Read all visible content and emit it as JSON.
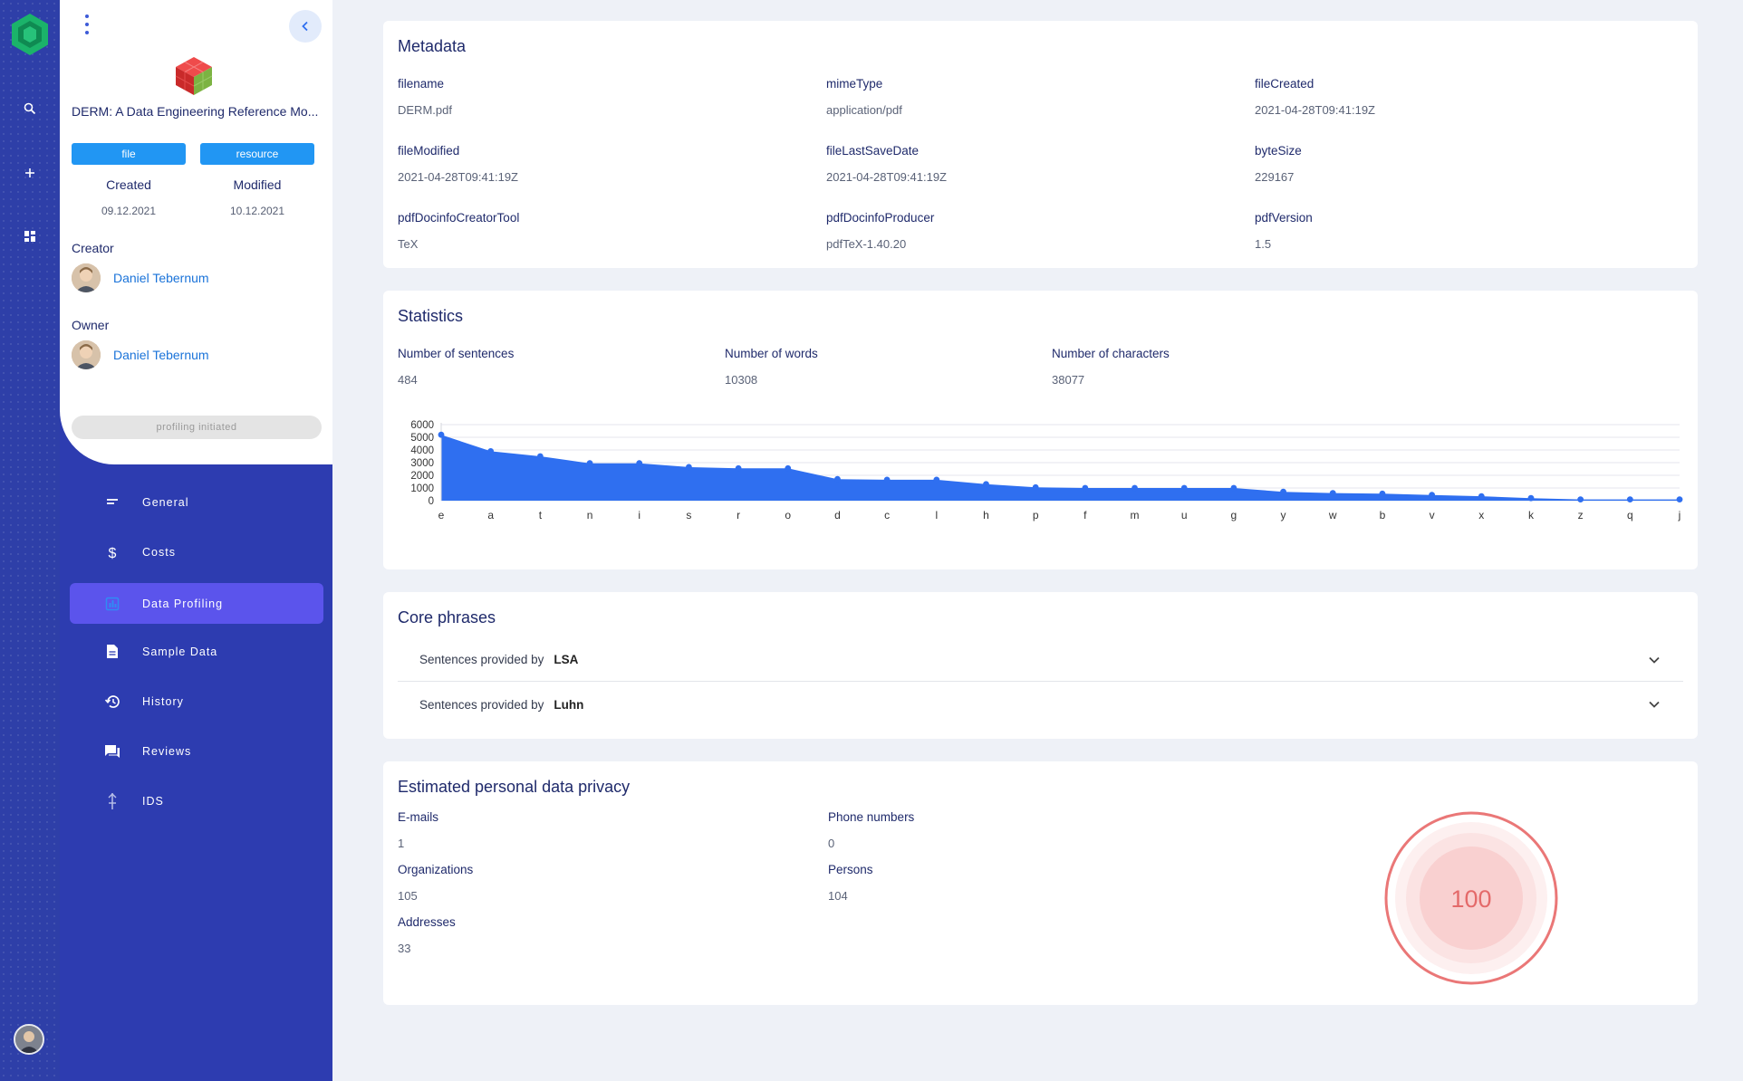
{
  "asset": {
    "title": "DERM: A Data Engineering Reference Mo...",
    "tags": [
      "file",
      "resource"
    ],
    "created_label": "Created",
    "created_value": "09.12.2021",
    "modified_label": "Modified",
    "modified_value": "10.12.2021",
    "creator_label": "Creator",
    "creator_name": "Daniel Tebernum",
    "owner_label": "Owner",
    "owner_name": "Daniel Tebernum",
    "status": "profiling initiated"
  },
  "nav": [
    {
      "label": "General",
      "icon": "notes-icon",
      "active": false
    },
    {
      "label": "Costs",
      "icon": "dollar-icon",
      "active": false
    },
    {
      "label": "Data Profiling",
      "icon": "profiling-icon",
      "active": true
    },
    {
      "label": "Sample Data",
      "icon": "document-icon",
      "active": false
    },
    {
      "label": "History",
      "icon": "history-icon",
      "active": false
    },
    {
      "label": "Reviews",
      "icon": "chat-icon",
      "active": false
    },
    {
      "label": "IDS",
      "icon": "ids-icon",
      "active": false
    }
  ],
  "metadata": {
    "title": "Metadata",
    "fields": [
      {
        "label": "filename",
        "value": "DERM.pdf"
      },
      {
        "label": "mimeType",
        "value": "application/pdf"
      },
      {
        "label": "fileCreated",
        "value": "2021-04-28T09:41:19Z"
      },
      {
        "label": "fileModified",
        "value": "2021-04-28T09:41:19Z"
      },
      {
        "label": "fileLastSaveDate",
        "value": "2021-04-28T09:41:19Z"
      },
      {
        "label": "byteSize",
        "value": "229167"
      },
      {
        "label": "pdfDocinfoCreatorTool",
        "value": "TeX"
      },
      {
        "label": "pdfDocinfoProducer",
        "value": "pdfTeX-1.40.20"
      },
      {
        "label": "pdfVersion",
        "value": "1.5"
      }
    ]
  },
  "statistics": {
    "title": "Statistics",
    "fields": [
      {
        "label": "Number of sentences",
        "value": "484"
      },
      {
        "label": "Number of words",
        "value": "10308"
      },
      {
        "label": "Number of characters",
        "value": "38077"
      }
    ]
  },
  "chart_data": {
    "type": "area",
    "categories": [
      "e",
      "a",
      "t",
      "n",
      "i",
      "s",
      "r",
      "o",
      "d",
      "c",
      "l",
      "h",
      "p",
      "f",
      "m",
      "u",
      "g",
      "y",
      "w",
      "b",
      "v",
      "x",
      "k",
      "z",
      "q",
      "j"
    ],
    "values": [
      5200,
      3900,
      3500,
      2950,
      2950,
      2650,
      2550,
      2550,
      1700,
      1650,
      1650,
      1300,
      1050,
      1000,
      1000,
      1000,
      1000,
      700,
      600,
      550,
      450,
      350,
      200,
      100,
      100,
      100
    ],
    "yticks": [
      0,
      1000,
      2000,
      3000,
      4000,
      5000,
      6000
    ],
    "ylim": [
      0,
      6000
    ],
    "color": "#2f6ff0",
    "grid": true
  },
  "core_phrases": {
    "title": "Core phrases",
    "rows": [
      {
        "prefix": "Sentences provided by",
        "by": "LSA"
      },
      {
        "prefix": "Sentences provided by",
        "by": "Luhn"
      }
    ]
  },
  "privacy": {
    "title": "Estimated personal data privacy",
    "fields": [
      {
        "label": "E-mails",
        "value": "1"
      },
      {
        "label": "Phone numbers",
        "value": "0"
      },
      {
        "label": "Organizations",
        "value": "105"
      },
      {
        "label": "Persons",
        "value": "104"
      },
      {
        "label": "Addresses",
        "value": "33"
      }
    ],
    "score": "100",
    "score_color": "#ea7777"
  }
}
